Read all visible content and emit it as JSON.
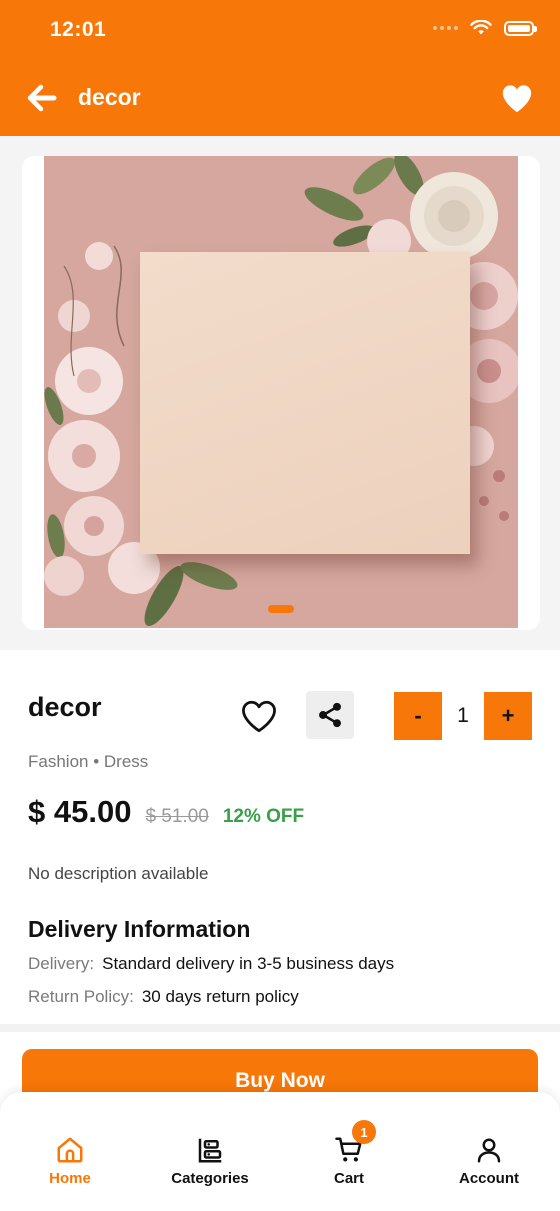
{
  "status_bar": {
    "time": "12:01"
  },
  "header": {
    "title": "decor"
  },
  "gallery": {
    "active_index": 0,
    "page_count": 1
  },
  "product": {
    "name": "decor",
    "category": "Fashion",
    "subcategory": "Dress",
    "category_line": "Fashion • Dress",
    "price": "$ 45.00",
    "old_price": "$ 51.00",
    "discount": "12% OFF",
    "description": "No description available"
  },
  "quantity": {
    "minus_label": "-",
    "value": "1",
    "plus_label": "+"
  },
  "delivery": {
    "title": "Delivery Information",
    "delivery_label": "Delivery:",
    "delivery_value": "Standard delivery in 3-5 business days",
    "return_label": "Return Policy:",
    "return_value": "30 days return policy"
  },
  "actions": {
    "buy_now_label": "Buy Now"
  },
  "bottom_nav": {
    "items": [
      {
        "label": "Home",
        "icon": "home-icon",
        "active": true
      },
      {
        "label": "Categories",
        "icon": "categories-icon",
        "active": false
      },
      {
        "label": "Cart",
        "icon": "cart-icon",
        "active": false,
        "badge": "1"
      },
      {
        "label": "Account",
        "icon": "account-icon",
        "active": false
      }
    ]
  },
  "colors": {
    "accent": "#f77708",
    "discount": "#3aa047",
    "muted": "#777777"
  }
}
